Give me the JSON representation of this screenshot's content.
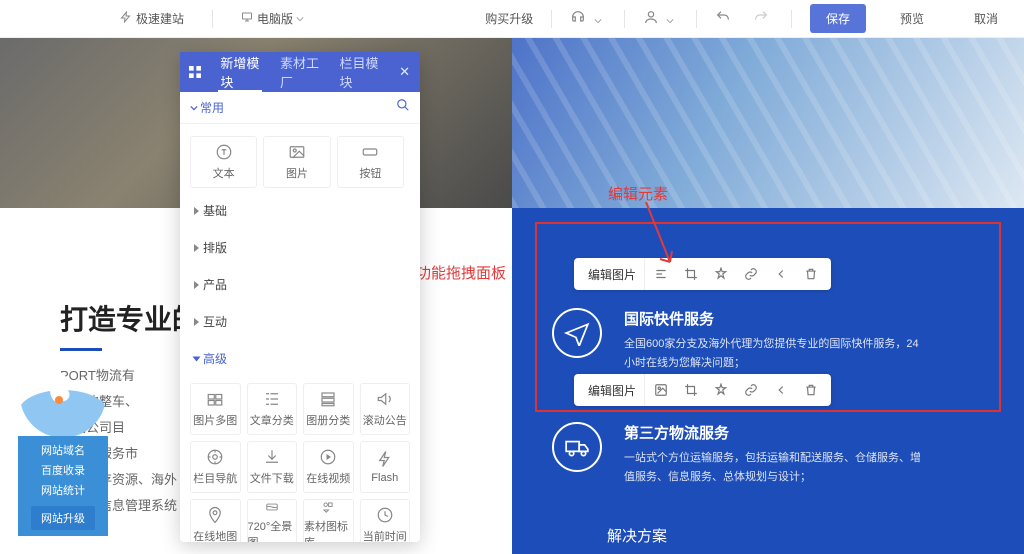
{
  "topbar": {
    "speed": "极速建站",
    "view": "电脑版",
    "upgrade": "购买升级",
    "save": "保存",
    "preview": "预览",
    "cancel": "取消"
  },
  "panel": {
    "tabs": [
      "新增模块",
      "素材工厂",
      "栏目模块"
    ],
    "category": "常用",
    "search_placeholder": "",
    "common": [
      {
        "icon": "text",
        "label": "文本"
      },
      {
        "icon": "image",
        "label": "图片"
      },
      {
        "icon": "button",
        "label": "按钮"
      }
    ],
    "groups": [
      "基础",
      "排版",
      "产品",
      "互动"
    ],
    "adv_label": "高级",
    "adv_row1": [
      {
        "label": "图片多图"
      },
      {
        "label": "文章分类"
      },
      {
        "label": "图册分类"
      },
      {
        "label": "滚动公告"
      }
    ],
    "adv_row2": [
      {
        "label": "栏目导航"
      },
      {
        "label": "文件下载"
      },
      {
        "label": "在线视频"
      },
      {
        "label": "Flash"
      }
    ],
    "adv_row3": [
      {
        "label": "在线地图"
      },
      {
        "label": "720°全景图"
      },
      {
        "label": "素材图标库"
      },
      {
        "label": "当前时间"
      }
    ]
  },
  "annotations": {
    "drag": "功能拖拽面板",
    "edit": "编辑元素"
  },
  "edit_bar_label": "编辑图片",
  "left_block": {
    "title": "打造专业的",
    "p1": "PORT物流有",
    "p2": "各地的整车、",
    "p3": "，我公司目",
    "p4": "的物流服务市",
    "p5": "输、库存资源、海外                                           以其",
    "p6": "                的物流信息管理系统"
  },
  "services": {
    "s1": {
      "title": "国际快件服务",
      "desc": "全国600家分支及海外代理为您提供专业的国际快件服务，24小时在线为您解决问题；"
    },
    "s2": {
      "title": "第三方物流服务",
      "desc": "一站式个方位运输服务，包括运输和配送服务、仓储服务、增值服务、信息服务、总体规划与设计；"
    },
    "section": "解决方案"
  },
  "float_tool": {
    "l1": "网站域名",
    "l2": "百度收录",
    "l3": "网站统计",
    "btn": "网站升级"
  }
}
